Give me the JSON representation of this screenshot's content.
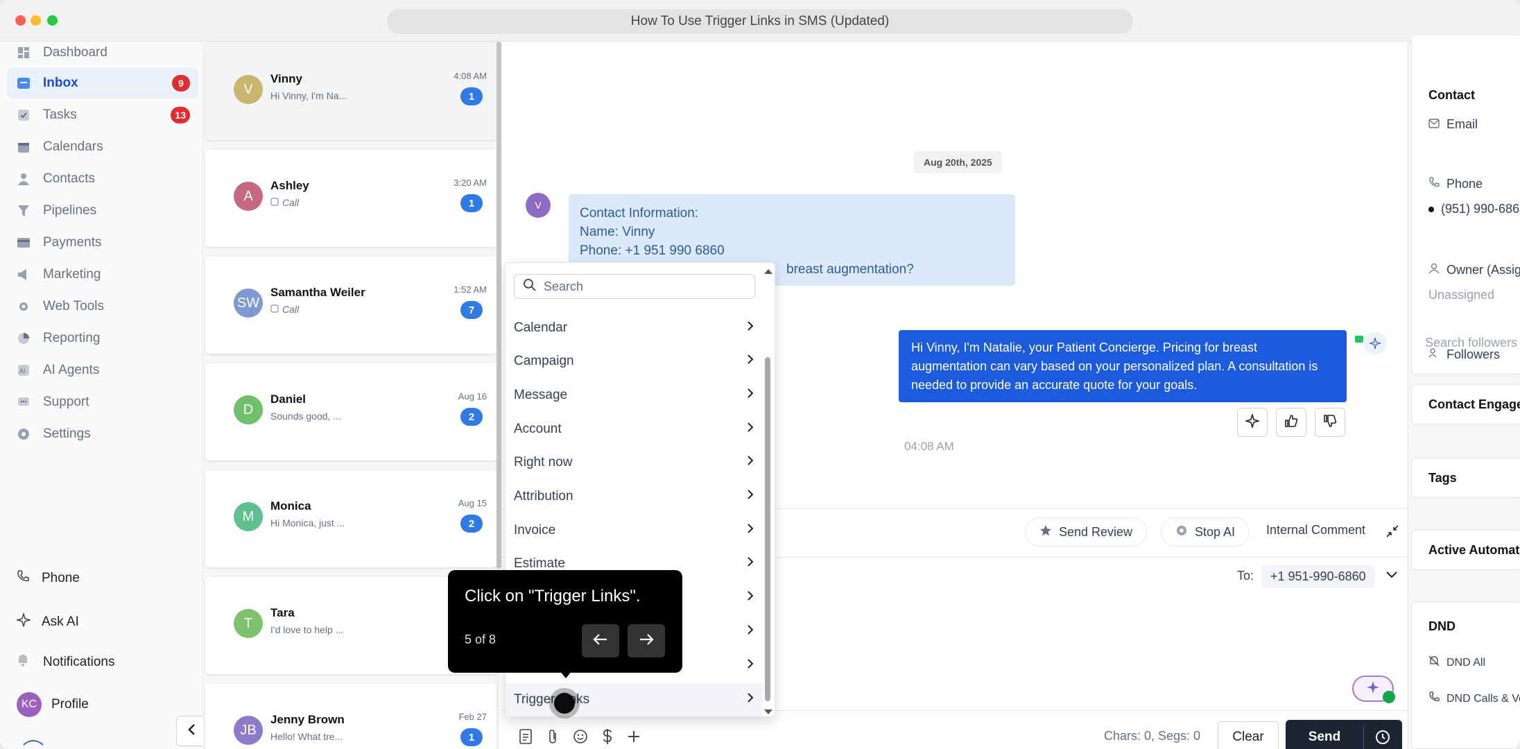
{
  "window": {
    "title": "How To Use Trigger Links in SMS (Updated)"
  },
  "sidebar": {
    "items": [
      {
        "label": "Dashboard",
        "icon": "dashboard-icon"
      },
      {
        "label": "Inbox",
        "icon": "inbox-icon",
        "badge": "9",
        "active": true
      },
      {
        "label": "Tasks",
        "icon": "tasks-icon",
        "badge": "13"
      },
      {
        "label": "Calendars",
        "icon": "calendar-icon"
      },
      {
        "label": "Contacts",
        "icon": "contacts-icon"
      },
      {
        "label": "Pipelines",
        "icon": "pipelines-icon"
      },
      {
        "label": "Payments",
        "icon": "payments-icon"
      },
      {
        "label": "Marketing",
        "icon": "marketing-icon"
      },
      {
        "label": "Web Tools",
        "icon": "web-tools-icon"
      },
      {
        "label": "Reporting",
        "icon": "reporting-icon"
      },
      {
        "label": "AI Agents",
        "icon": "ai-agents-icon"
      },
      {
        "label": "Support",
        "icon": "support-icon"
      },
      {
        "label": "Settings",
        "icon": "settings-icon"
      }
    ],
    "bottom": {
      "phone": "Phone",
      "ask_ai": "Ask AI",
      "notifications": "Notifications",
      "profile": "Profile",
      "profile_initials": "KC"
    }
  },
  "conversations": [
    {
      "initials": "V",
      "name": "Vinny",
      "preview": "Hi Vinny, I'm Na...",
      "time": "4:08 AM",
      "unread": "1",
      "color": "#c9b56e"
    },
    {
      "initials": "A",
      "name": "Ashley",
      "preview": "Call",
      "time": "3:20 AM",
      "unread": "1",
      "color": "#c4697e"
    },
    {
      "initials": "SW",
      "name": "Samantha Weiler",
      "preview": "Call",
      "time": "1:52 AM",
      "unread": "7",
      "color": "#7f9ad3"
    },
    {
      "initials": "D",
      "name": "Daniel",
      "preview": "Sounds good, ...",
      "time": "Aug 16",
      "unread": "2",
      "color": "#6fbf6b"
    },
    {
      "initials": "M",
      "name": "Monica",
      "preview": "Hi Monica, just ...",
      "time": "Aug 15",
      "unread": "2",
      "color": "#5fbf8f"
    },
    {
      "initials": "T",
      "name": "Tara",
      "preview": "I'd love to help ...",
      "time": "",
      "unread": "",
      "color": "#7dc36d"
    },
    {
      "initials": "JB",
      "name": "Jenny Brown",
      "preview": "Hello! What tre...",
      "time": "Feb 27",
      "unread": "1",
      "color": "#8b7bc9"
    }
  ],
  "chat": {
    "date": "Aug 20th, 2025",
    "incoming_initial": "V",
    "incoming": [
      "Contact Information:",
      "Name: Vinny",
      "Phone: +1 951 990 6860",
      "breast augmentation?"
    ],
    "outgoing": "Hi Vinny, I'm Natalie, your Patient Concierge. Pricing for breast augmentation can vary based on your personalized plan. A consultation is needed to provide an accurate quote for your goals.",
    "time": "04:08 AM",
    "send_review": "Send Review",
    "stop_ai": "Stop AI",
    "internal_comment": "Internal Comment",
    "to_label": "To:",
    "to_value": "+1 951-990-6860",
    "chars": "Chars: 0, Segs: 0",
    "clear": "Clear",
    "send": "Send"
  },
  "dropdown": {
    "search_placeholder": "Search",
    "items": [
      "Calendar",
      "Campaign",
      "Message",
      "Account",
      "Right now",
      "Attribution",
      "Invoice",
      "Estimate",
      "Trigger Links"
    ]
  },
  "tooltip": {
    "text": "Click on \"Trigger Links\".",
    "step": "5 of 8"
  },
  "right_panel": {
    "contact": "Contact",
    "email": "Email",
    "phone": "Phone",
    "phone_value": "(951) 990-686",
    "owner": "Owner (Assig",
    "owner_value": "Unassigned",
    "followers": "Followers",
    "followers_placeholder": "Search followers",
    "engagement": "Contact Engage",
    "tags": "Tags",
    "automations": "Active Automati",
    "dnd": "DND",
    "dnd_all": "DND All",
    "dnd_calls": "DND Calls & Vo"
  },
  "colors": {
    "accent": "#1d5bde",
    "badge": "#e12d2d",
    "unread": "#2f7ae5",
    "send": "#1b2533"
  }
}
